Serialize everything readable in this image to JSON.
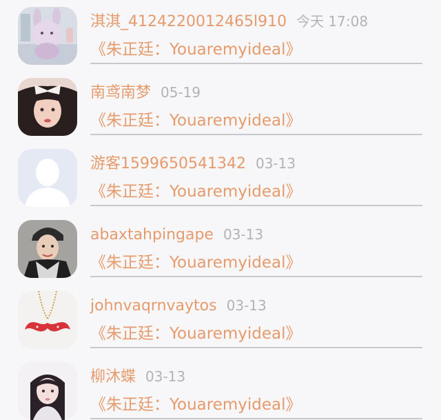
{
  "comments": [
    {
      "user": "淇淇_4124220012465l910",
      "time": "今天 17:08",
      "song": "《朱正廷：Youaremyideal》",
      "avatar": "plush-toy-photo"
    },
    {
      "user": "南鸢南梦",
      "time": "05-19",
      "song": "《朱正廷：Youaremyideal》",
      "avatar": "girl-with-bow-photo"
    },
    {
      "user": "游客1599650541342",
      "time": "03-13",
      "song": "《朱正廷：Youaremyideal》",
      "avatar": "default-user-silhouette"
    },
    {
      "user": "abaxtahpingape",
      "time": "03-13",
      "song": "《朱正廷：Youaremyideal》",
      "avatar": "man-with-cap-photo"
    },
    {
      "user": "johnvaqrnvaytos",
      "time": "03-13",
      "song": "《朱正廷：Youaremyideal》",
      "avatar": "mustache-necklace-photo"
    },
    {
      "user": "柳沐蝶",
      "time": "03-13",
      "song": "《朱正廷：Youaremyideal》",
      "avatar": "girl-portrait-photo"
    }
  ]
}
